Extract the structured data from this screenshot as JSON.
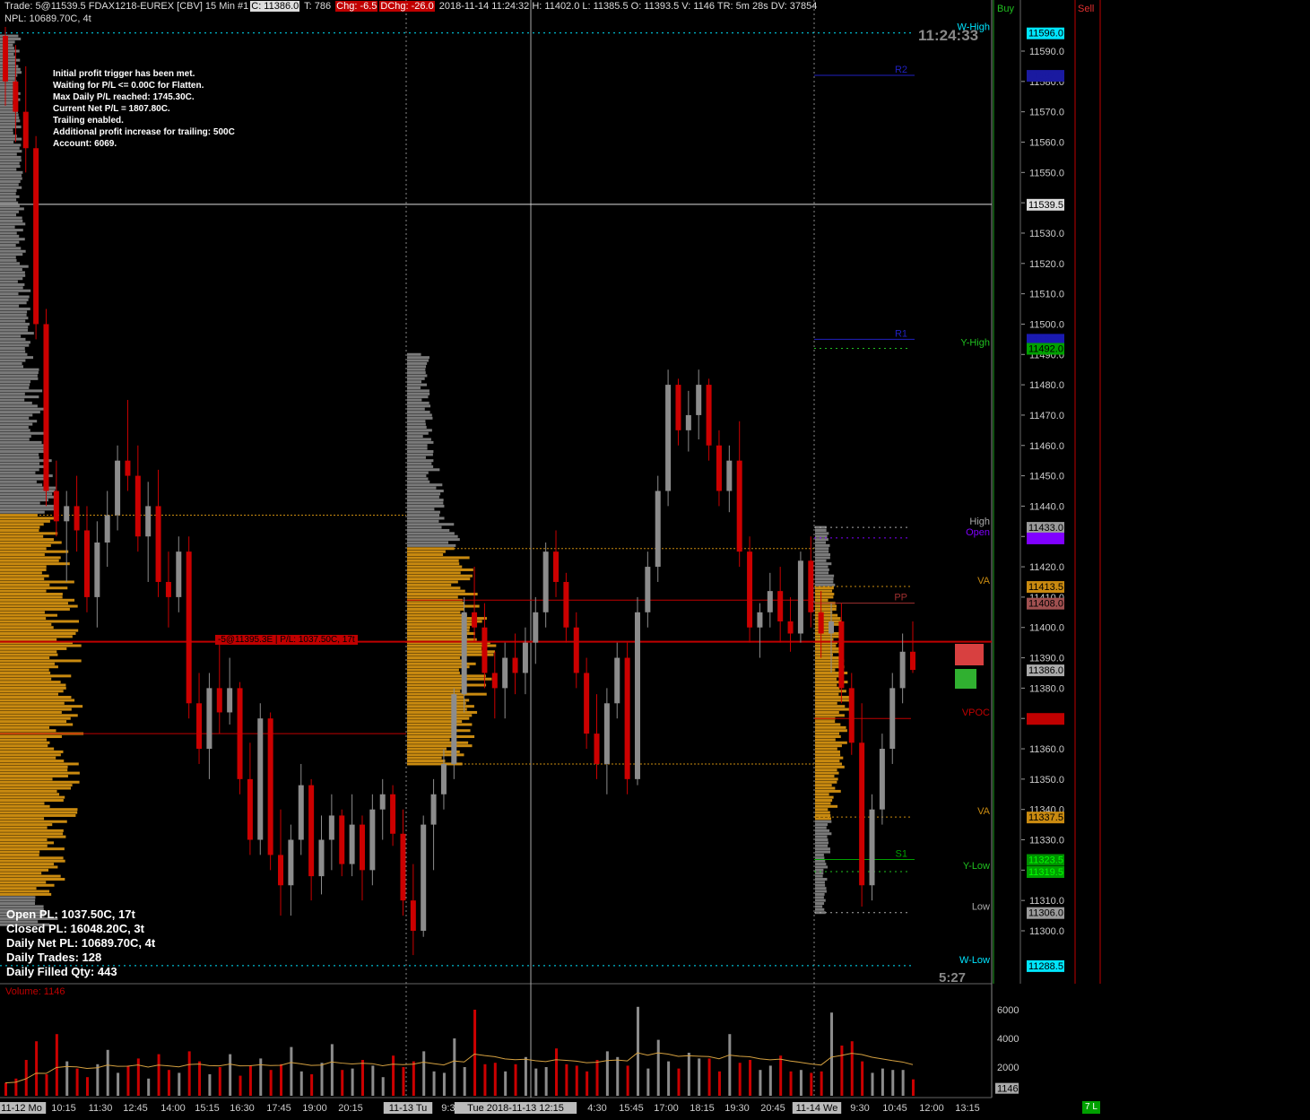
{
  "header": {
    "line1_prefix": "Trade: 5@11539.5  FDAX1218-EUREX [CBV]  15 Min   #1",
    "close": "C: 11386.0",
    "ticks": "T: 786",
    "chg": "Chg: -6.5",
    "dchg": "DChg: -26.0",
    "line1_suffix": "2018-11-14 11:24:32 H: 11402.0  L: 11385.5  O: 11393.5  V: 1146  TR: 5m 28s  DV: 37854",
    "line2": "NPL: 10689.70C, 4t"
  },
  "info_panel": [
    "Initial profit trigger has been met.",
    "Waiting for P/L <= 0.00C for Flatten.",
    "Max Daily P/L reached: 1745.30C.",
    "Current Net P/L = 1807.80C.",
    "Trailing enabled.",
    "Additional profit increase for trailing: 500C",
    "Account: 6069."
  ],
  "pl_panel": [
    "Open PL: 1037.50C, 17t",
    "Closed PL: 16048.20C, 3t",
    "Daily Net PL: 10689.70C, 4t",
    "Daily Trades: 128",
    "Daily Filled Qty: 443"
  ],
  "position_label": "-5@11395.3E | P/L: 1037.50C, 17t",
  "clock": "11:24:33",
  "bar_timer": "5:27",
  "volume_label": "Volume: 1146",
  "buy_label": "Buy",
  "sell_label": "Sell",
  "status_badge": "7 L",
  "colors": {
    "up": "#8c8c8c",
    "down": "#cc0000",
    "profile_value_area": "#c98a10",
    "profile_outside": "#7a7a7a",
    "volume_line": "#d4a040"
  },
  "chart_data": [
    {
      "type": "candlestick",
      "ylim": [
        11288,
        11600
      ],
      "y_ticks": [
        11590.0,
        11580.0,
        11570.0,
        11560.0,
        11550.0,
        11540.0,
        11530.0,
        11520.0,
        11510.0,
        11500.0,
        11490.0,
        11480.0,
        11470.0,
        11460.0,
        11450.0,
        11440.0,
        11430.0,
        11420.0,
        11410.0,
        11400.0,
        11390.0,
        11380.0,
        11370.0,
        11360.0,
        11350.0,
        11340.0,
        11330.0,
        11320.0,
        11310.0,
        11300.0
      ],
      "x_labels": [
        "11-12 Mo",
        "10:15",
        "11:30",
        "12:45",
        "14:00",
        "15:15",
        "16:30",
        "17:45",
        "19:00",
        "20:15",
        "11-13 Tu",
        "9:30",
        "Tue 2018-11-13  12:15",
        "4:30",
        "15:45",
        "17:00",
        "18:15",
        "19:30",
        "20:45",
        "11-14 We",
        "9:30",
        "10:45",
        "12:00",
        "13:15"
      ],
      "candles": [
        [
          11595,
          11598,
          11572,
          11580
        ],
        [
          11580,
          11592,
          11560,
          11570
        ],
        [
          11570,
          11585,
          11550,
          11558
        ],
        [
          11558,
          11562,
          11495,
          11500
        ],
        [
          11500,
          11505,
          11440,
          11445
        ],
        [
          11445,
          11455,
          11430,
          11435
        ],
        [
          11435,
          11445,
          11415,
          11440
        ],
        [
          11440,
          11450,
          11425,
          11432
        ],
        [
          11432,
          11440,
          11405,
          11410
        ],
        [
          11410,
          11435,
          11400,
          11428
        ],
        [
          11428,
          11445,
          11420,
          11437
        ],
        [
          11437,
          11460,
          11432,
          11455
        ],
        [
          11455,
          11475,
          11445,
          11450
        ],
        [
          11450,
          11460,
          11425,
          11430
        ],
        [
          11430,
          11448,
          11415,
          11440
        ],
        [
          11440,
          11452,
          11410,
          11415
        ],
        [
          11415,
          11425,
          11400,
          11410
        ],
        [
          11410,
          11430,
          11405,
          11425
        ],
        [
          11425,
          11430,
          11370,
          11375
        ],
        [
          11375,
          11385,
          11355,
          11360
        ],
        [
          11360,
          11385,
          11350,
          11380
        ],
        [
          11380,
          11395,
          11365,
          11372
        ],
        [
          11372,
          11390,
          11368,
          11380
        ],
        [
          11380,
          11382,
          11345,
          11350
        ],
        [
          11350,
          11362,
          11325,
          11330
        ],
        [
          11330,
          11375,
          11325,
          11370
        ],
        [
          11370,
          11372,
          11320,
          11325
        ],
        [
          11325,
          11340,
          11305,
          11315
        ],
        [
          11315,
          11335,
          11305,
          11330
        ],
        [
          11330,
          11355,
          11325,
          11348
        ],
        [
          11348,
          11350,
          11310,
          11318
        ],
        [
          11318,
          11338,
          11312,
          11330
        ],
        [
          11330,
          11345,
          11320,
          11338
        ],
        [
          11338,
          11340,
          11318,
          11322
        ],
        [
          11322,
          11345,
          11318,
          11335
        ],
        [
          11335,
          11338,
          11310,
          11320
        ],
        [
          11320,
          11345,
          11315,
          11340
        ],
        [
          11340,
          11350,
          11330,
          11345
        ],
        [
          11345,
          11348,
          11328,
          11332
        ],
        [
          11332,
          11340,
          11305,
          11310
        ],
        [
          11310,
          11322,
          11292,
          11300
        ],
        [
          11300,
          11338,
          11298,
          11335
        ],
        [
          11335,
          11350,
          11320,
          11345
        ],
        [
          11345,
          11360,
          11340,
          11355
        ],
        [
          11355,
          11380,
          11350,
          11378
        ],
        [
          11378,
          11410,
          11372,
          11405
        ],
        [
          11405,
          11420,
          11395,
          11400
        ],
        [
          11400,
          11408,
          11380,
          11385
        ],
        [
          11385,
          11392,
          11370,
          11380
        ],
        [
          11380,
          11395,
          11370,
          11390
        ],
        [
          11390,
          11398,
          11378,
          11385
        ],
        [
          11385,
          11400,
          11378,
          11395
        ],
        [
          11395,
          11410,
          11388,
          11405
        ],
        [
          11405,
          11428,
          11400,
          11425
        ],
        [
          11425,
          11432,
          11410,
          11415
        ],
        [
          11415,
          11418,
          11395,
          11400
        ],
        [
          11400,
          11405,
          11380,
          11385
        ],
        [
          11385,
          11390,
          11360,
          11365
        ],
        [
          11365,
          11378,
          11350,
          11355
        ],
        [
          11355,
          11380,
          11345,
          11375
        ],
        [
          11375,
          11395,
          11370,
          11390
        ],
        [
          11390,
          11395,
          11345,
          11350
        ],
        [
          11350,
          11410,
          11348,
          11405
        ],
        [
          11405,
          11425,
          11400,
          11420
        ],
        [
          11420,
          11450,
          11415,
          11445
        ],
        [
          11445,
          11485,
          11440,
          11480
        ],
        [
          11480,
          11482,
          11460,
          11465
        ],
        [
          11465,
          11478,
          11458,
          11470
        ],
        [
          11470,
          11485,
          11462,
          11480
        ],
        [
          11480,
          11482,
          11455,
          11460
        ],
        [
          11460,
          11465,
          11440,
          11445
        ],
        [
          11445,
          11460,
          11438,
          11455
        ],
        [
          11455,
          11468,
          11420,
          11425
        ],
        [
          11425,
          11430,
          11395,
          11400
        ],
        [
          11400,
          11408,
          11390,
          11405
        ],
        [
          11405,
          11418,
          11400,
          11412
        ],
        [
          11412,
          11420,
          11395,
          11402
        ],
        [
          11402,
          11410,
          11392,
          11398
        ],
        [
          11398,
          11425,
          11395,
          11422
        ],
        [
          11422,
          11430,
          11400,
          11405
        ],
        [
          11405,
          11412,
          11390,
          11398
        ],
        [
          11398,
          11408,
          11385,
          11402
        ],
        [
          11402,
          11408,
          11375,
          11380
        ],
        [
          11380,
          11385,
          11358,
          11362
        ],
        [
          11362,
          11375,
          11308,
          11315
        ],
        [
          11315,
          11345,
          11310,
          11340
        ],
        [
          11340,
          11365,
          11335,
          11360
        ],
        [
          11360,
          11385,
          11355,
          11380
        ],
        [
          11380,
          11398,
          11375,
          11392
        ],
        [
          11392,
          11402,
          11385,
          11386
        ]
      ],
      "levels": [
        {
          "label": "W-High",
          "price": 11596.0
        },
        {
          "label": "R2",
          "price": 11582.0
        },
        {
          "label": "R1",
          "price": 11495.0
        },
        {
          "label": "Y-High",
          "price": 11492.0
        },
        {
          "label": "High",
          "price": 11433.0
        },
        {
          "label": "Open",
          "price": 11429.5
        },
        {
          "label": "VA",
          "price": 11413.5
        },
        {
          "label": "PP",
          "price": 11408.0
        },
        {
          "label": "VPOC",
          "price": 11370.0
        },
        {
          "label": "VA",
          "price": 11337.5
        },
        {
          "label": "S1",
          "price": 11323.5
        },
        {
          "label": "Y-Low",
          "price": 11319.5
        },
        {
          "label": "Low",
          "price": 11306.0
        },
        {
          "label": "W-Low",
          "price": 11288.5
        }
      ],
      "price_tags": [
        {
          "text": "11596.0",
          "price": 11596.0,
          "color": "#00e5ff",
          "fg": "#000"
        },
        {
          "text": "11582.0",
          "price": 11582.0,
          "color": "#1a1aa0",
          "fg": "#1a1aa0"
        },
        {
          "text": "11539.5",
          "price": 11539.5,
          "color": "#dddddd",
          "fg": "#000"
        },
        {
          "text": "11495.0",
          "price": 11495.0,
          "color": "#1a1ab0",
          "fg": "#1a1ab0"
        },
        {
          "text": "11492.0",
          "price": 11492.0,
          "color": "#00a000",
          "fg": "#000"
        },
        {
          "text": "11433.0",
          "price": 11433.0,
          "color": "#9a9a9a",
          "fg": "#000"
        },
        {
          "text": "11429.5",
          "price": 11429.5,
          "color": "#8000ff",
          "fg": "#8000ff"
        },
        {
          "text": "11413.5",
          "price": 11413.5,
          "color": "#c98a10",
          "fg": "#000"
        },
        {
          "text": "11408.0",
          "price": 11408.0,
          "color": "#a05050",
          "fg": "#000"
        },
        {
          "text": "11386.0",
          "price": 11386.0,
          "color": "#aaaaaa",
          "fg": "#000"
        },
        {
          "text": "11370.0",
          "price": 11370.0,
          "color": "#c00000",
          "fg": "#c00000"
        },
        {
          "text": "11337.5",
          "price": 11337.5,
          "color": "#c98a10",
          "fg": "#000"
        },
        {
          "text": "11323.5",
          "price": 11323.5,
          "color": "#009000",
          "fg": "#00ff00"
        },
        {
          "text": "11319.5",
          "price": 11319.5,
          "color": "#00a000",
          "fg": "#00ff00"
        },
        {
          "text": "11306.0",
          "price": 11306.0,
          "color": "#9a9a9a",
          "fg": "#000"
        },
        {
          "text": "11288.5",
          "price": 11288.5,
          "color": "#00e5ff",
          "fg": "#000"
        }
      ]
    },
    {
      "type": "bar",
      "title": "Volume: 1146",
      "ylim": [
        0,
        7000
      ],
      "y_ticks": [
        6000,
        4000,
        2000
      ],
      "last_value": 1146,
      "values": [
        900,
        1200,
        2500,
        3800,
        1500,
        4300,
        2400,
        1900,
        1300,
        2200,
        3200,
        1600,
        2100,
        2600,
        1200,
        2900,
        1800,
        1600,
        3100,
        2400,
        1500,
        2000,
        2900,
        1400,
        2100,
        2600,
        1800,
        2200,
        3400,
        1700,
        1500,
        2300,
        3600,
        1800,
        1900,
        2500,
        2100,
        1300,
        2800,
        2000,
        2400,
        3100,
        1700,
        1600,
        4000,
        2000,
        6000,
        2200,
        2300,
        1700,
        2200,
        2700,
        1900,
        2000,
        3300,
        2200,
        2100,
        1700,
        2500,
        3100,
        2700,
        2100,
        6200,
        1900,
        3900,
        2400,
        1900,
        3000,
        2600,
        2600,
        1700,
        4300,
        2300,
        2500,
        1800,
        2100,
        2800,
        1700,
        1800,
        1600,
        1700,
        5800,
        3500,
        3800,
        2400,
        1600,
        1900,
        1800,
        1800,
        1146
      ]
    }
  ]
}
